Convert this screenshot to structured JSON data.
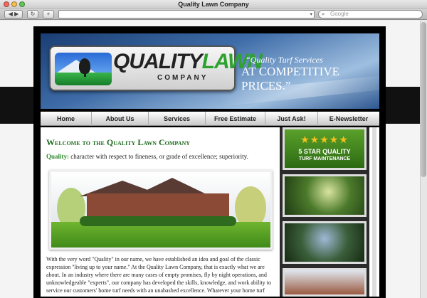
{
  "browser": {
    "title": "Quality Lawn Company",
    "back_label": "◀ ▶",
    "reload_label": "↻",
    "add_label": "+",
    "url": "",
    "search_placeholder": "Google"
  },
  "header": {
    "logo_word_quality": "QUALITY",
    "logo_word_lawn": "LAWN",
    "logo_company": "COMPANY",
    "tagline_line1": "“Quality Turf Services",
    "tagline_line2": "AT COMPETITIVE PRICES.”"
  },
  "nav": {
    "items": [
      "Home",
      "About Us",
      "Services",
      "Free Estimate",
      "Just Ask!",
      "E-Newsletter"
    ]
  },
  "content": {
    "welcome_title": "Welcome to the Quality Lawn Company",
    "quality_keyword": "Quality:",
    "quality_definition": " character with respect to fineness, or grade of excellence; superiority.",
    "body_text": "With the very word \"Quality\" in our name, we have established an idea and goal of the classic expression \"living up to your name.\" At the Quality Lawn Company, that is exactly what we are about. In an industry where there are many cases of empty promises, fly by night operations, and unknowledgeable \"experts\", our company has developed the skills, knowledge, and work ability to service our customers' home turf needs with an unabashed excellence. Whatever your home turf"
  },
  "sidebar": {
    "promo_stars": "★★★★★",
    "promo_title": "5 STAR QUALITY",
    "promo_subtitle": "TURF MAINTENANCE"
  },
  "colors": {
    "accent_green": "#2ea12e",
    "heading_green": "#1d6b1d",
    "header_blue": "#3e6ca8"
  }
}
